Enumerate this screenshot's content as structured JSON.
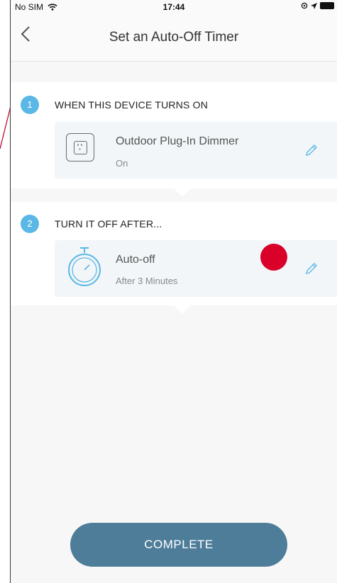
{
  "status_bar": {
    "carrier": "No SIM",
    "wifi_icon": "wifi-icon",
    "time": "17:44",
    "right_icons": [
      "lock-rotation-icon",
      "location-icon",
      "battery-icon"
    ]
  },
  "navbar": {
    "back_icon": "chevron-left-icon",
    "title": "Set an Auto-Off Timer"
  },
  "steps": [
    {
      "number": "1",
      "label": "WHEN THIS DEVICE TURNS ON",
      "card": {
        "icon": "outlet-icon",
        "name": "Outdoor Plug-In Dimmer",
        "status": "On",
        "edit_icon": "pencil-icon"
      }
    },
    {
      "number": "2",
      "label": "TURN IT OFF AFTER...",
      "card": {
        "icon": "stopwatch-icon",
        "name": "Auto-off",
        "status": "After 3 Minutes",
        "edit_icon": "pencil-icon"
      }
    }
  ],
  "complete_button": {
    "label": "COMPLETE"
  },
  "colors": {
    "accent_blue": "#5bb8e6",
    "button": "#4e7d9a",
    "marker_red": "#d9002a",
    "card_bg": "#f2f6f8"
  }
}
